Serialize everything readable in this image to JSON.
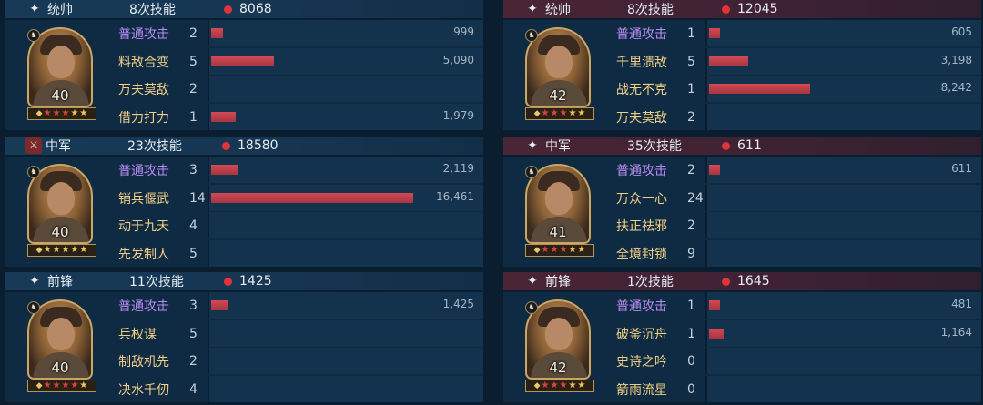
{
  "max_damage": 16461,
  "left": [
    {
      "role": "统帅",
      "role_icon": "sparkle-icon",
      "casts": "8次技能",
      "damage": "8068",
      "level": "40",
      "stars": [
        "diamond",
        "red",
        "red",
        "red",
        "gold",
        "gold"
      ],
      "skills": [
        {
          "name": "普通攻击",
          "level": "2",
          "value": "999",
          "amount": 999,
          "type": "basic"
        },
        {
          "name": "料敌合变",
          "level": "5",
          "value": "5,090",
          "amount": 5090,
          "type": "skill"
        },
        {
          "name": "万夫莫敌",
          "level": "2",
          "value": "",
          "amount": 0,
          "type": "skill"
        },
        {
          "name": "借力打力",
          "level": "1",
          "value": "1,979",
          "amount": 1979,
          "type": "skill"
        }
      ]
    },
    {
      "role": "中军",
      "role_icon": "sword-emblem-icon",
      "casts": "23次技能",
      "damage": "18580",
      "level": "40",
      "stars": [
        "diamond",
        "gold",
        "gold",
        "gold",
        "gold",
        "gold"
      ],
      "skills": [
        {
          "name": "普通攻击",
          "level": "3",
          "value": "2,119",
          "amount": 2119,
          "type": "basic"
        },
        {
          "name": "销兵偃武",
          "level": "14",
          "value": "16,461",
          "amount": 16461,
          "type": "skill"
        },
        {
          "name": "动于九天",
          "level": "4",
          "value": "",
          "amount": 0,
          "type": "skill"
        },
        {
          "name": "先发制人",
          "level": "5",
          "value": "",
          "amount": 0,
          "type": "skill"
        }
      ]
    },
    {
      "role": "前锋",
      "role_icon": "sparkle-icon",
      "casts": "11次技能",
      "damage": "1425",
      "level": "40",
      "stars": [
        "diamond",
        "red",
        "red",
        "red",
        "red",
        "gold"
      ],
      "skills": [
        {
          "name": "普通攻击",
          "level": "3",
          "value": "1,425",
          "amount": 1425,
          "type": "basic"
        },
        {
          "name": "兵权谋",
          "level": "5",
          "value": "",
          "amount": 0,
          "type": "skill"
        },
        {
          "name": "制敌机先",
          "level": "2",
          "value": "",
          "amount": 0,
          "type": "skill"
        },
        {
          "name": "决水千仞",
          "level": "4",
          "value": "",
          "amount": 0,
          "type": "skill"
        }
      ]
    }
  ],
  "right": [
    {
      "role": "统帅",
      "role_icon": "sparkle-icon",
      "casts": "8次技能",
      "damage": "12045",
      "level": "42",
      "stars": [
        "diamond",
        "red",
        "red",
        "red",
        "gold",
        "gold"
      ],
      "skills": [
        {
          "name": "普通攻击",
          "level": "1",
          "value": "605",
          "amount": 605,
          "type": "basic"
        },
        {
          "name": "千里溃敌",
          "level": "5",
          "value": "3,198",
          "amount": 3198,
          "type": "skill"
        },
        {
          "name": "战无不克",
          "level": "1",
          "value": "8,242",
          "amount": 8242,
          "type": "skill"
        },
        {
          "name": "万夫莫敌",
          "level": "2",
          "value": "",
          "amount": 0,
          "type": "skill"
        }
      ]
    },
    {
      "role": "中军",
      "role_icon": "sparkle-icon",
      "casts": "35次技能",
      "damage": "611",
      "level": "41",
      "stars": [
        "diamond",
        "red",
        "red",
        "red",
        "gold",
        "gold"
      ],
      "skills": [
        {
          "name": "普通攻击",
          "level": "2",
          "value": "611",
          "amount": 611,
          "type": "basic"
        },
        {
          "name": "万众一心",
          "level": "24",
          "value": "",
          "amount": 0,
          "type": "skill"
        },
        {
          "name": "扶正祛邪",
          "level": "2",
          "value": "",
          "amount": 0,
          "type": "skill"
        },
        {
          "name": "全境封锁",
          "level": "9",
          "value": "",
          "amount": 0,
          "type": "skill"
        }
      ]
    },
    {
      "role": "前锋",
      "role_icon": "sparkle-icon",
      "casts": "1次技能",
      "damage": "1645",
      "level": "42",
      "stars": [
        "diamond",
        "red",
        "red",
        "red",
        "gold",
        "gold"
      ],
      "skills": [
        {
          "name": "普通攻击",
          "level": "1",
          "value": "481",
          "amount": 481,
          "type": "basic"
        },
        {
          "name": "破釜沉舟",
          "level": "1",
          "value": "1,164",
          "amount": 1164,
          "type": "skill"
        },
        {
          "name": "史诗之吟",
          "level": "0",
          "value": "",
          "amount": 0,
          "type": "skill"
        },
        {
          "name": "箭雨流星",
          "level": "0",
          "value": "",
          "amount": 0,
          "type": "skill"
        }
      ]
    }
  ]
}
